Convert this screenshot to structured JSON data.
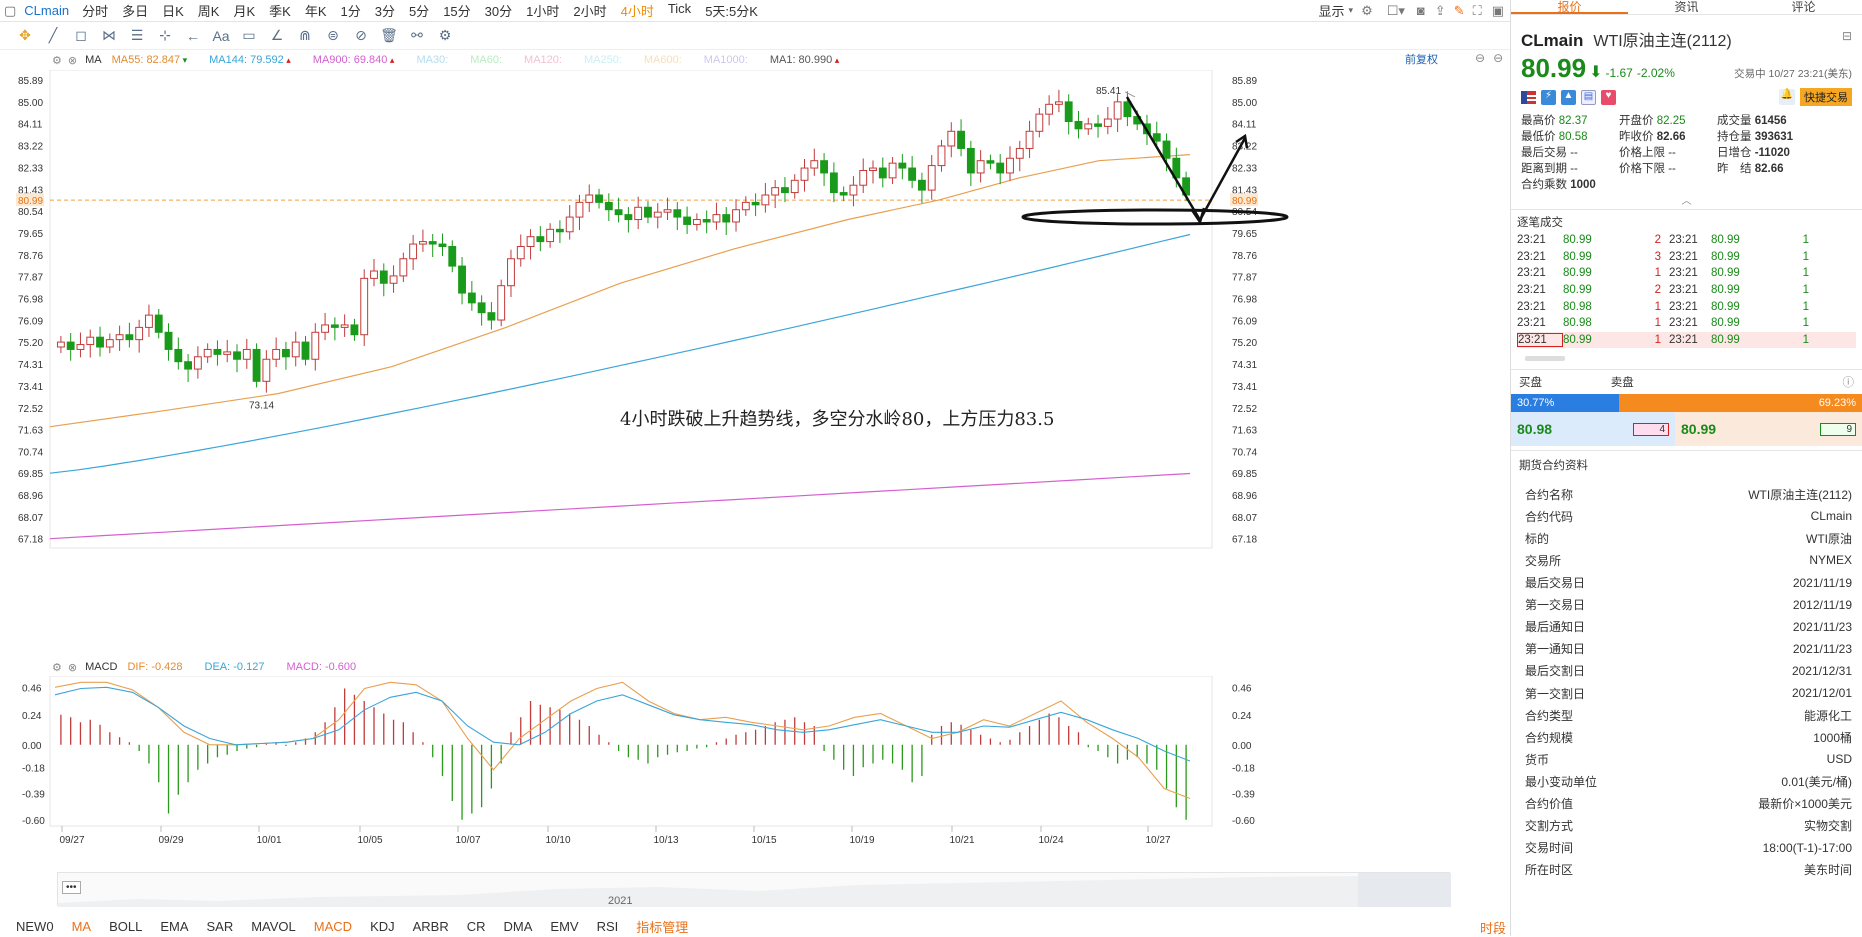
{
  "topbar": {
    "symbol": "CLmain",
    "timeframes": [
      "分时",
      "多日",
      "日K",
      "周K",
      "月K",
      "季K",
      "年K",
      "1分",
      "3分",
      "5分",
      "15分",
      "30分",
      "1小时",
      "2小时",
      "4小时",
      "Tick",
      "5天:5分K"
    ],
    "active_timeframe": "4小时",
    "display_label": "显示"
  },
  "main_chart": {
    "indicator_name": "MA",
    "restore_label": "前复权",
    "ma_items": [
      {
        "label": "MA55: 82.847",
        "color": "#e38b2f"
      },
      {
        "label": "MA144: 79.592",
        "color": "#3aa5d8"
      },
      {
        "label": "MA900: 69.840",
        "color": "#d45fd0"
      },
      {
        "label": "MA30:",
        "color": "#b5dcec"
      },
      {
        "label": "MA60:",
        "color": "#b8ecc0"
      },
      {
        "label": "MA120:",
        "color": "#f2c2d0"
      },
      {
        "label": "MA250:",
        "color": "#c8f0f4"
      },
      {
        "label": "MA600:",
        "color": "#f6dfb8"
      },
      {
        "label": "MA1000:",
        "color": "#cfc6ee"
      },
      {
        "label": "MA1: 80.990",
        "color": "#555555"
      }
    ],
    "y_ticks": [
      "85.89",
      "85.00",
      "84.11",
      "83.22",
      "82.33",
      "81.43",
      "80.99",
      "80.54",
      "79.65",
      "78.76",
      "77.87",
      "76.98",
      "76.09",
      "75.20",
      "74.31",
      "73.41",
      "72.52",
      "71.63",
      "70.74",
      "69.85",
      "68.96",
      "68.07",
      "67.18"
    ],
    "high_label": "85.41",
    "low_label": "73.14",
    "current_price_label": "80.99",
    "annotation": "4小时跌破上升趋势线，多空分水岭80，上方压力83.5"
  },
  "chart_data": [
    {
      "type": "candlestick",
      "title": "CLmain 4小时",
      "ylim": [
        66.8,
        86.3
      ],
      "x_tick_labels": [
        "09/27",
        "09/29",
        "10/01",
        "10/05",
        "10/07",
        "10/10",
        "10/13",
        "10/15",
        "10/19",
        "10/21",
        "10/24",
        "10/27"
      ],
      "close_trace": [
        75.2,
        74.9,
        75.1,
        75.4,
        75.0,
        75.3,
        75.5,
        75.3,
        75.8,
        76.3,
        75.6,
        74.9,
        74.4,
        74.1,
        74.6,
        74.9,
        74.7,
        74.8,
        74.5,
        74.9,
        73.6,
        74.5,
        74.9,
        74.6,
        75.2,
        74.5,
        75.6,
        75.9,
        75.8,
        75.9,
        75.5,
        77.8,
        78.1,
        77.6,
        77.9,
        78.6,
        79.2,
        79.3,
        79.2,
        79.1,
        78.3,
        77.2,
        76.8,
        76.4,
        76.1,
        77.5,
        78.6,
        79.1,
        79.5,
        79.3,
        79.8,
        79.7,
        80.3,
        80.9,
        81.2,
        80.9,
        80.6,
        80.4,
        80.2,
        80.7,
        80.3,
        80.5,
        80.6,
        80.3,
        80.0,
        80.2,
        80.1,
        80.4,
        80.1,
        80.6,
        80.9,
        80.8,
        81.2,
        81.5,
        81.3,
        81.8,
        82.3,
        82.6,
        82.1,
        81.3,
        81.2,
        81.6,
        82.2,
        82.3,
        81.9,
        82.5,
        82.3,
        81.8,
        81.4,
        82.4,
        83.2,
        83.8,
        83.1,
        82.1,
        82.6,
        82.5,
        82.1,
        82.7,
        83.1,
        83.8,
        84.5,
        84.9,
        85.0,
        84.2,
        83.9,
        84.1,
        84.0,
        84.3,
        85.0,
        84.4,
        84.1,
        83.7,
        83.4,
        82.7,
        81.9,
        81.2
      ],
      "volume_note": "",
      "ma_series": [
        {
          "name": "MA55",
          "start": 71.7,
          "end": 82.85
        },
        {
          "name": "MA144",
          "start": 69.85,
          "end": 79.59
        },
        {
          "name": "MA900",
          "start": 67.18,
          "end": 69.84
        }
      ]
    },
    {
      "type": "bar",
      "title": "MACD",
      "ylim": [
        -0.65,
        0.55
      ],
      "y_ticks": [
        "0.46",
        "0.24",
        "0.00",
        "-0.18",
        "-0.39",
        "-0.60"
      ],
      "dif": -0.428,
      "dea": -0.127,
      "macd": -0.6
    }
  ],
  "macd_header": {
    "name": "MACD",
    "dif_label": "DIF: -0.428",
    "dea_label": "DEA: -0.127",
    "macd_label": "MACD: -0.600"
  },
  "navigator": {
    "year_label": "2021",
    "more_label": "•••"
  },
  "bottom_tabs": [
    "NEW0",
    "MA",
    "BOLL",
    "EMA",
    "SAR",
    "MAVOL",
    "MACD",
    "KDJ",
    "ARBR",
    "CR",
    "DMA",
    "EMV",
    "RSI",
    "指标管理"
  ],
  "bottom_tabs_highlight": [
    "MA",
    "MACD",
    "指标管理"
  ],
  "bottom_right_label": "时段",
  "right_panel": {
    "tabs": [
      "报价",
      "资讯",
      "评论"
    ],
    "symbol": "CLmain",
    "name": "WTI原油主连(2112)",
    "price": "80.99",
    "change": "-1.67",
    "change_pct": "-2.02%",
    "status": "交易中 10/27 23:21(美东)",
    "quick_trade": "快捷交易",
    "stats": [
      [
        "最高价",
        "82.37",
        "开盘价",
        "82.25",
        "成交量",
        "61456"
      ],
      [
        "最低价",
        "80.58",
        "昨收价",
        "82.66",
        "持仓量",
        "393631"
      ],
      [
        "最后交易",
        "--",
        "价格上限",
        "--",
        "日增仓",
        "-11020"
      ],
      [
        "距离到期",
        "--",
        "价格下限",
        "--",
        "昨　结",
        "82.66"
      ],
      [
        "合约乘数",
        "1000",
        "",
        "",
        "",
        ""
      ]
    ],
    "trades_title": "逐笔成交",
    "trades": [
      [
        "23:21",
        "80.99",
        "2",
        "23:21",
        "80.99",
        "1"
      ],
      [
        "23:21",
        "80.99",
        "3",
        "23:21",
        "80.99",
        "1"
      ],
      [
        "23:21",
        "80.99",
        "1",
        "23:21",
        "80.99",
        "1"
      ],
      [
        "23:21",
        "80.99",
        "2",
        "23:21",
        "80.99",
        "1"
      ],
      [
        "23:21",
        "80.98",
        "1",
        "23:21",
        "80.99",
        "1"
      ],
      [
        "23:21",
        "80.98",
        "1",
        "23:21",
        "80.99",
        "1"
      ],
      [
        "23:21",
        "80.99",
        "1",
        "23:21",
        "80.99",
        "1"
      ]
    ],
    "first_trade_time": "23:21",
    "buy_label": "买盘",
    "sell_label": "卖盘",
    "buy_pct": "30.77%",
    "sell_pct": "69.23%",
    "buy_ratio": 0.3077,
    "bid_price": "80.98",
    "bid_qty": "4",
    "ask_price": "80.99",
    "ask_qty": "9",
    "spec_title": "期货合约资料",
    "specs": [
      [
        "合约名称",
        "WTI原油主连(2112)"
      ],
      [
        "合约代码",
        "CLmain"
      ],
      [
        "标的",
        "WTI原油"
      ],
      [
        "交易所",
        "NYMEX"
      ],
      [
        "最后交易日",
        "2021/11/19"
      ],
      [
        "第一交易日",
        "2012/11/19"
      ],
      [
        "最后通知日",
        "2021/11/23"
      ],
      [
        "第一通知日",
        "2021/11/23"
      ],
      [
        "最后交割日",
        "2021/12/31"
      ],
      [
        "第一交割日",
        "2021/12/01"
      ],
      [
        "合约类型",
        "能源化工"
      ],
      [
        "合约规模",
        "1000桶"
      ],
      [
        "货币",
        "USD"
      ],
      [
        "最小变动单位",
        "0.01(美元/桶)"
      ],
      [
        "合约价值",
        "最新价×1000美元"
      ],
      [
        "交割方式",
        "实物交割"
      ],
      [
        "交易时间",
        "18:00(T-1)-17:00"
      ],
      [
        "所在时区",
        "美东时间"
      ]
    ]
  }
}
